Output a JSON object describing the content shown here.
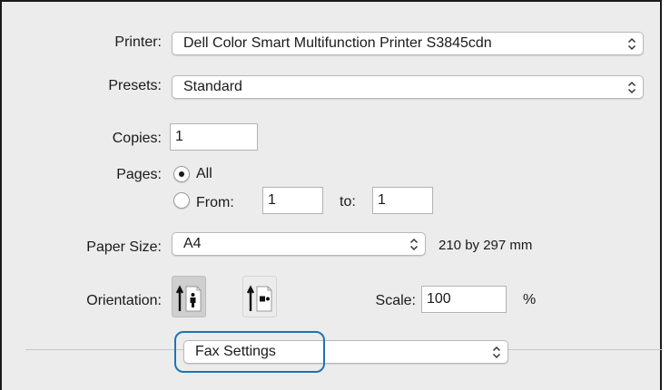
{
  "printer": {
    "label": "Printer:",
    "value": "Dell Color Smart Multifunction Printer S3845cdn"
  },
  "presets": {
    "label": "Presets:",
    "value": "Standard"
  },
  "copies": {
    "label": "Copies:",
    "value": "1"
  },
  "pages": {
    "label": "Pages:",
    "all_label": "All",
    "from_label": "From:",
    "from_value": "1",
    "to_label": "to:",
    "to_value": "1",
    "selected": "All"
  },
  "paper_size": {
    "label": "Paper Size:",
    "value": "A4",
    "dimensions": "210 by 297 mm"
  },
  "orientation": {
    "label": "Orientation:",
    "selected": "portrait"
  },
  "scale": {
    "label": "Scale:",
    "value": "100",
    "unit": "%"
  },
  "section_popup": {
    "value": "Fax Settings"
  },
  "icons": {
    "popup_chevron": "up-down-chevron-icon",
    "portrait": "portrait-orientation-icon",
    "landscape": "landscape-orientation-icon"
  },
  "colors": {
    "highlight": "#1f73b0",
    "dialog_bg": "#ececec"
  }
}
